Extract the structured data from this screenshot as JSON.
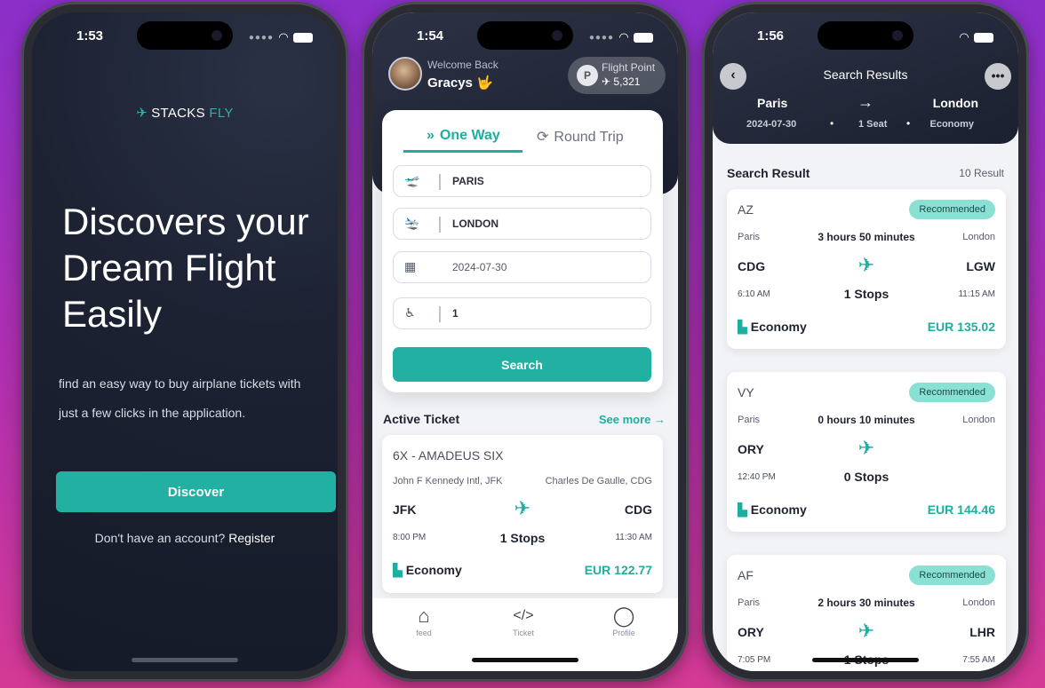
{
  "phone1": {
    "status_time": "1:53",
    "brand_first": "STACKS",
    "brand_second": "FLY",
    "headline": "Discovers your Dream Flight Easily",
    "subtitle": "find an easy way to buy airplane tickets with just a few clicks in the application.",
    "discover_label": "Discover",
    "account_prompt": "Don't have an account?",
    "register_label": "Register"
  },
  "phone2": {
    "status_time": "1:54",
    "welcome": "Welcome Back",
    "username": "Gracys 🤟",
    "points_badge": "P",
    "points_label": "Flight Point",
    "points_value": "5,321",
    "tabs": [
      {
        "label": "One Way",
        "active": true
      },
      {
        "label": "Round Trip",
        "active": false
      }
    ],
    "fields": {
      "from": "PARIS",
      "to": "LONDON",
      "date": "2024-07-30",
      "passengers": "1"
    },
    "search_label": "Search",
    "active_ticket_title": "Active Ticket",
    "see_more": "See more",
    "ticket": {
      "airline": "6X  - AMADEUS SIX",
      "from_city": "John F Kennedy Intl, JFK",
      "to_city": "Charles De Gaulle, CDG",
      "from_code": "JFK",
      "to_code": "CDG",
      "departure": "8:00 PM",
      "arrival": "11:30 AM",
      "stops": "1 Stops",
      "class": "Economy",
      "price": "EUR 122.77"
    },
    "nav": [
      {
        "label": "feed",
        "icon": "home-icon"
      },
      {
        "label": "Ticket",
        "icon": "code-icon"
      },
      {
        "label": "Profile",
        "icon": "user-icon"
      }
    ]
  },
  "phone3": {
    "status_time": "1:56",
    "title": "Search Results",
    "from": "Paris",
    "to": "London",
    "date": "2024-07-30",
    "seats": "1 Seat",
    "class": "Economy",
    "result_title": "Search Result",
    "result_count": "10 Result",
    "results": [
      {
        "airline": "AZ",
        "badge": "Recommended",
        "from_city": "Paris",
        "to_city": "London",
        "duration": "3 hours 50 minutes",
        "from_code": "CDG",
        "to_code": "LGW",
        "departure": "6:10 AM",
        "arrival": "11:15 AM",
        "stops": "1 Stops",
        "class": "Economy",
        "price": "EUR 135.02"
      },
      {
        "airline": "VY",
        "badge": "Recommended",
        "from_city": "Paris",
        "to_city": "London",
        "duration": "0 hours 10 minutes",
        "from_code": "ORY",
        "to_code": "",
        "departure": "12:40 PM",
        "arrival": "",
        "stops": "0 Stops",
        "class": "Economy",
        "price": "EUR 144.46"
      },
      {
        "airline": "AF",
        "badge": "Recommended",
        "from_city": "Paris",
        "to_city": "London",
        "duration": "2 hours 30 minutes",
        "from_code": "ORY",
        "to_code": "LHR",
        "departure": "7:05 PM",
        "arrival": "7:55 AM",
        "stops": "1 Stops",
        "class": "",
        "price": ""
      }
    ]
  },
  "colors": {
    "accent": "#21b0a1",
    "badge": "#8be0d4",
    "dark_bg": "#1c2232",
    "background_gradient_top": "#8a2fc9",
    "background_gradient_bottom": "#d43a95"
  }
}
